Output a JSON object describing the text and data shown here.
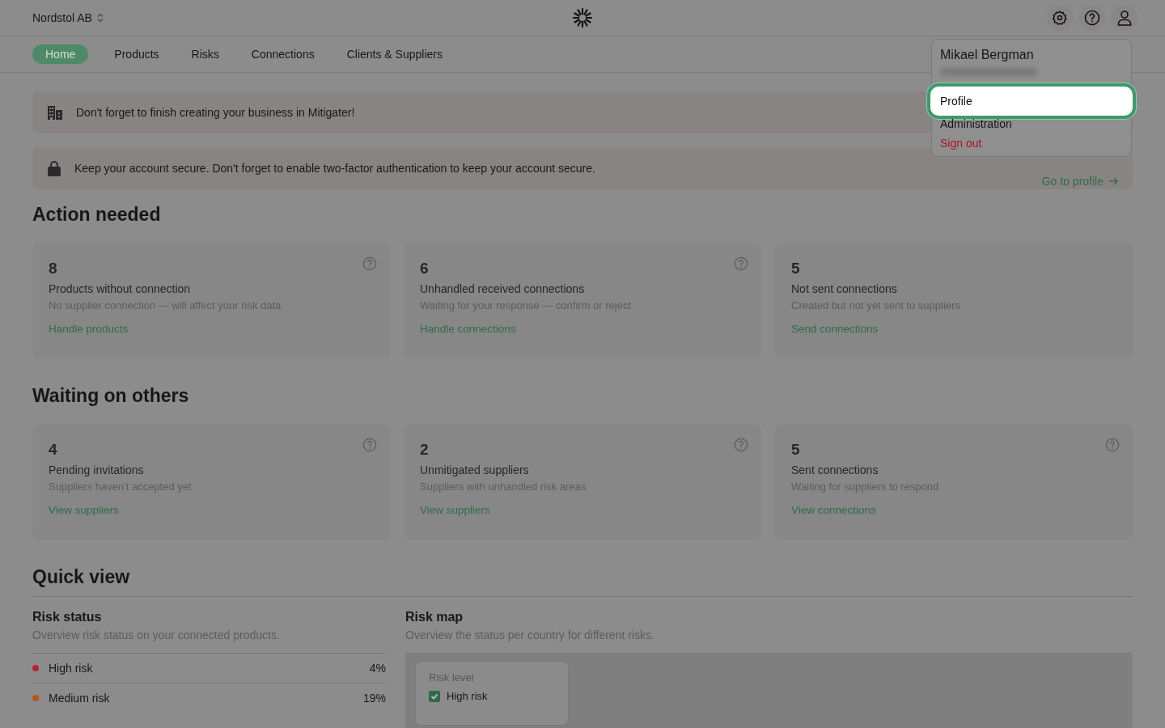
{
  "topbar": {
    "company": "Nordstol AB"
  },
  "nav": [
    {
      "label": "Home",
      "selected": true
    },
    {
      "label": "Products",
      "selected": false
    },
    {
      "label": "Risks",
      "selected": false
    },
    {
      "label": "Connections",
      "selected": false
    },
    {
      "label": "Clients & Suppliers",
      "selected": false
    }
  ],
  "banners": [
    {
      "kind": "business",
      "text": "Don't forget to finish creating your business in Mitigater!"
    },
    {
      "kind": "security",
      "text": "Keep your account secure. Don't forget to enable two-factor authentication to keep your account secure.",
      "link": "Go to profile"
    }
  ],
  "sections": [
    {
      "title": "Action needed",
      "cards": [
        {
          "count": "8",
          "title": "Products without connection",
          "subtitle": "No supplier connection — will affect your risk data",
          "link": "Handle products",
          "help": true
        },
        {
          "count": "6",
          "title": "Unhandled received connections",
          "subtitle": "Waiting for your response — confirm or reject",
          "link": "Handle connections",
          "help": true
        },
        {
          "count": "5",
          "title": "Not sent connections",
          "subtitle": "Created but not yet sent to suppliers",
          "link": "Send connections",
          "help": false
        }
      ]
    },
    {
      "title": "Waiting on others",
      "cards": [
        {
          "count": "4",
          "title": "Pending invitations",
          "subtitle": "Suppliers haven't accepted yet",
          "link": "View suppliers",
          "help": true
        },
        {
          "count": "2",
          "title": "Unmitigated suppliers",
          "subtitle": "Suppliers with unhandled risk areas",
          "link": "View suppliers",
          "help": true
        },
        {
          "count": "5",
          "title": "Sent connections",
          "subtitle": "Waiting for suppliers to respond",
          "link": "View connections",
          "help": true
        }
      ]
    }
  ],
  "quick_view": {
    "title": "Quick view",
    "risk_status": {
      "title": "Risk status",
      "subtitle": "Overview risk status on your connected products.",
      "items": [
        {
          "label": "High risk",
          "value": "4%",
          "color": "#b3262e"
        },
        {
          "label": "Medium risk",
          "value": "19%",
          "color": "#b5561a"
        }
      ]
    },
    "risk_map": {
      "title": "Risk map",
      "subtitle": "Overview the status per country for different risks.",
      "legend": {
        "title": "Risk level",
        "items": [
          {
            "label": "High risk",
            "checked": true
          }
        ]
      }
    }
  },
  "user_menu": {
    "name": "Mikael Bergman",
    "items": [
      {
        "label": "Profile",
        "kind": "normal",
        "selected": true
      },
      {
        "label": "Administration",
        "kind": "normal",
        "selected": false
      },
      {
        "label": "Sign out",
        "kind": "danger",
        "selected": false
      }
    ]
  }
}
